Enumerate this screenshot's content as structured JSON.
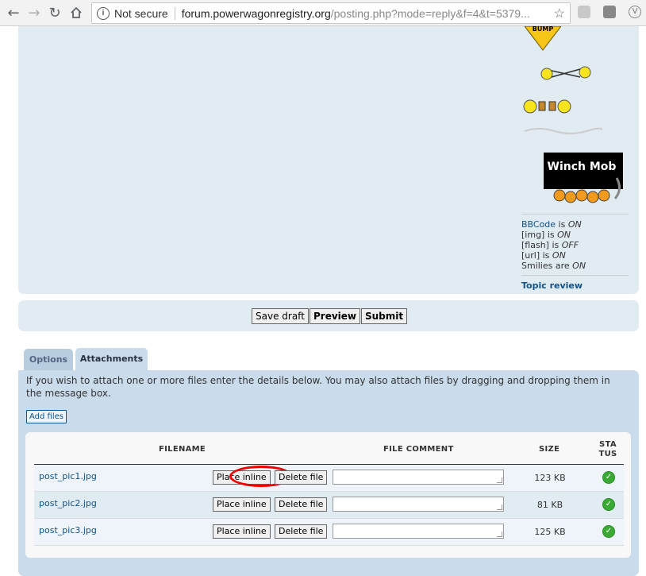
{
  "browser": {
    "security_label": "Not secure",
    "url_host": "forum.powerwagonregistry.org",
    "url_path": "/posting.php?mode=reply&f=4&t=5379..."
  },
  "smilies": {
    "bump_text": "BUMP",
    "winch_text": "Winch Mob",
    "bbcode_link": "BBCode",
    "bbcode_is": " is ",
    "bbcode_state": "ON",
    "img_label": "[img] is ",
    "img_state": "ON",
    "flash_label": "[flash] is ",
    "flash_state": "OFF",
    "url_label": "[url] is ",
    "url_state": "ON",
    "smilies_label": "Smilies are ",
    "smilies_state": "ON",
    "topic_review": "Topic review"
  },
  "buttons": {
    "save_draft": "Save draft",
    "preview": "Preview",
    "submit": "Submit"
  },
  "tabs": {
    "options": "Options",
    "attachments": "Attachments"
  },
  "attachments": {
    "help": "If you wish to attach one or more files enter the details below. You may also attach files by dragging and dropping them in the message box.",
    "add_files": "Add files",
    "headers": {
      "filename": "FILENAME",
      "comment": "FILE COMMENT",
      "size": "SIZE",
      "status": "STA TUS"
    },
    "place_inline": "Place inline",
    "delete_file": "Delete file",
    "files": [
      {
        "name": "post_pic1.jpg",
        "size": "123 KB"
      },
      {
        "name": "post_pic2.jpg",
        "size": "81 KB"
      },
      {
        "name": "post_pic3.jpg",
        "size": "125 KB"
      }
    ]
  },
  "colors": {
    "panel_bg": "#e1ebf2",
    "attach_panel_bg": "#cadceb",
    "link": "#105289",
    "status_ok": "#3aaa35",
    "highlight": "#e00000"
  }
}
